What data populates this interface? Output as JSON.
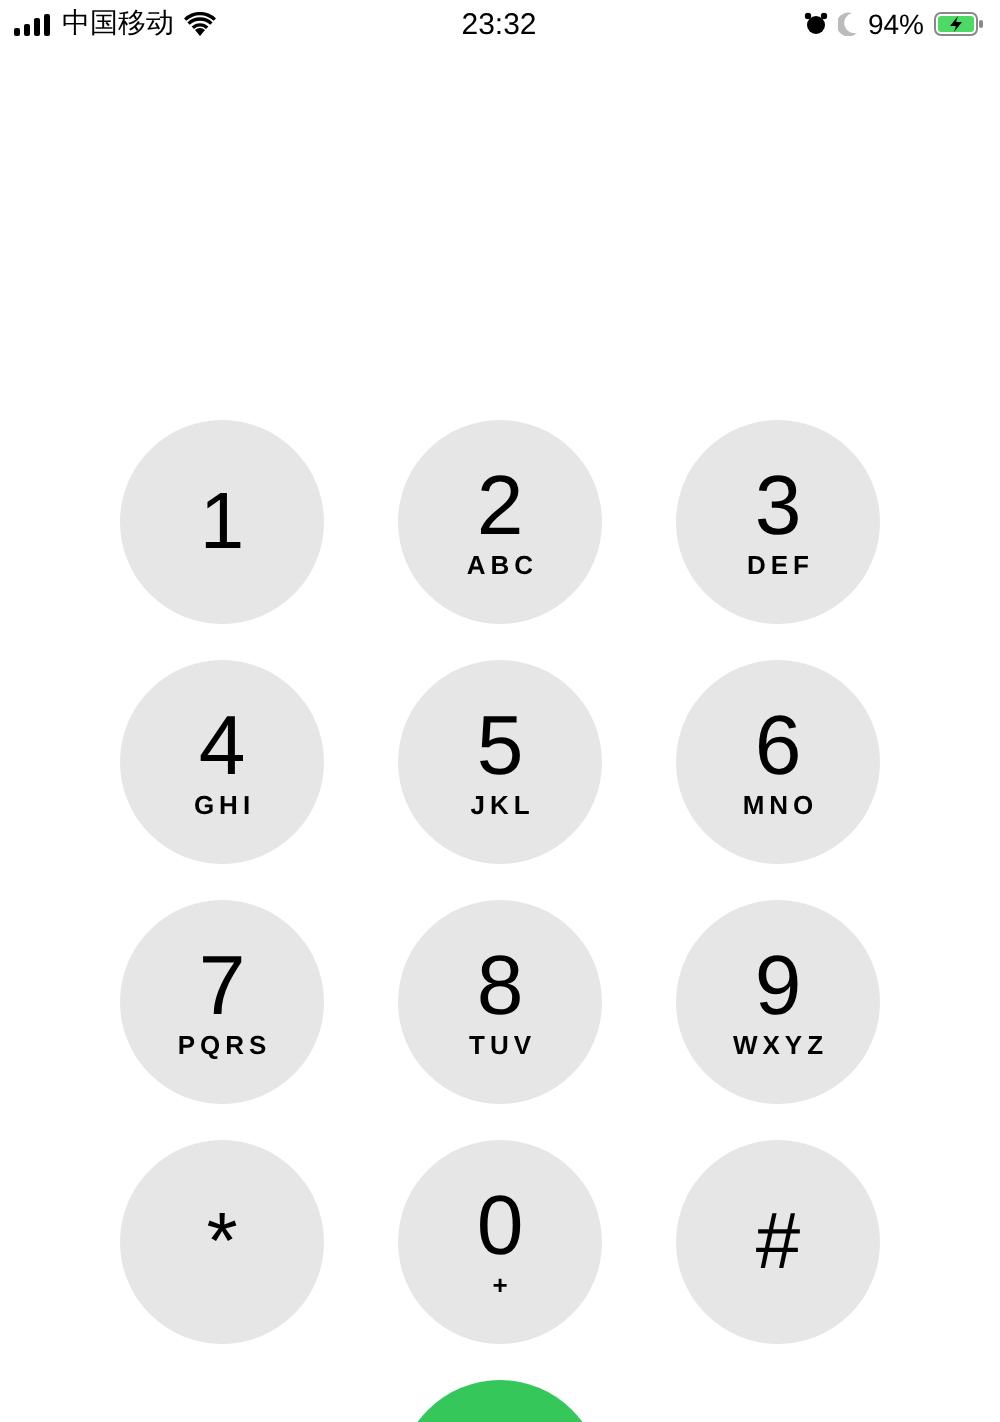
{
  "status_bar": {
    "carrier": "中国移动",
    "time": "23:32",
    "battery_percent": "94%"
  },
  "keypad": [
    {
      "digit": "1"
    },
    {
      "digit": "2",
      "letters": "ABC"
    },
    {
      "digit": "3",
      "letters": "DEF"
    },
    {
      "digit": "4",
      "letters": "GHI"
    },
    {
      "digit": "5",
      "letters": "JKL"
    },
    {
      "digit": "6",
      "letters": "MNO"
    },
    {
      "digit": "7",
      "letters": "PQRS"
    },
    {
      "digit": "8",
      "letters": "TUV"
    },
    {
      "digit": "9",
      "letters": "WXYZ"
    },
    {
      "digit": "*"
    },
    {
      "digit": "0",
      "letters": "+"
    },
    {
      "digit": "#"
    }
  ]
}
